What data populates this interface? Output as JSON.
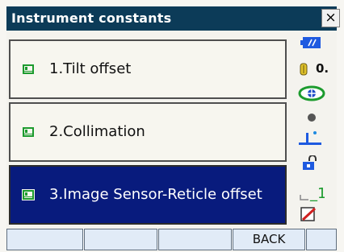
{
  "window": {
    "title": "Instrument constants",
    "close_glyph": "×"
  },
  "menu": {
    "items": [
      {
        "label": "1.Tilt offset",
        "icon": "green-book-icon",
        "selected": false
      },
      {
        "label": "2.Collimation",
        "icon": "green-book-icon",
        "selected": false
      },
      {
        "label": "3.Image Sensor-Reticle offset",
        "icon": "green-book-icon",
        "selected": true
      }
    ]
  },
  "status": {
    "battery_icon": "battery-icon",
    "atmos_value": "0.",
    "atmos_icon": "atmospheric-correction-icon",
    "target_icon": "target-prism-icon",
    "laser_icon": "laser-dot-icon",
    "tilt_icon": "tilt-compensation-icon",
    "lock_icon": "padlock-icon",
    "input_mode": "_1",
    "input_icon": "input-mode-icon",
    "memo_icon": "memo-icon"
  },
  "softkeys": [
    "",
    "",
    "",
    "BACK",
    ""
  ],
  "colors": {
    "titlebar": "#0c3b58",
    "selected": "#081b7d",
    "softkey": "#e1ebf7",
    "icon_green": "#1c9b2e",
    "battery": "#1e5ae0"
  }
}
